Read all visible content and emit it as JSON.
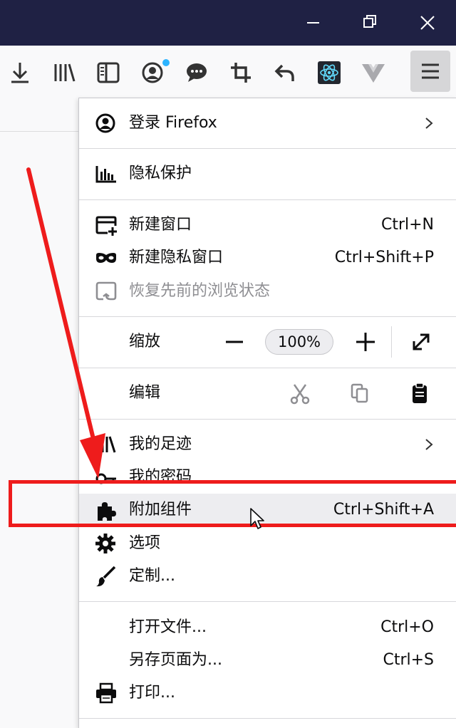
{
  "window_controls": {
    "minimize_icon": "minimize-icon",
    "restore_icon": "restore-icon",
    "close_icon": "close-icon"
  },
  "toolbar": {
    "icons": [
      "download-icon",
      "library-icon",
      "sidebar-icon",
      "account-icon",
      "chat-icon",
      "crop-icon",
      "undo-icon",
      "react-icon",
      "vue-icon",
      "hamburger-menu-icon"
    ]
  },
  "menu": {
    "sign_in": {
      "label": "登录 Firefox"
    },
    "privacy": {
      "label": "隐私保护"
    },
    "new_window": {
      "label": "新建窗口",
      "shortcut": "Ctrl+N"
    },
    "new_private_window": {
      "label": "新建隐私窗口",
      "shortcut": "Ctrl+Shift+P"
    },
    "restore_session": {
      "label": "恢复先前的浏览状态"
    },
    "zoom": {
      "label": "缩放",
      "value": "100%",
      "minus": "−",
      "plus": "+"
    },
    "edit": {
      "label": "编辑"
    },
    "library": {
      "label": "我的足迹"
    },
    "passwords": {
      "label": "我的密码"
    },
    "addons": {
      "label": "附加组件",
      "shortcut": "Ctrl+Shift+A"
    },
    "options": {
      "label": "选项"
    },
    "customize": {
      "label": "定制..."
    },
    "open_file": {
      "label": "打开文件...",
      "shortcut": "Ctrl+O"
    },
    "save_page": {
      "label": "另存页面为...",
      "shortcut": "Ctrl+S"
    },
    "print": {
      "label": "打印..."
    }
  },
  "colors": {
    "titlebar": "#1f2144",
    "annotation_red": "#ee1c1c",
    "notification_dot": "#2db4ff"
  }
}
